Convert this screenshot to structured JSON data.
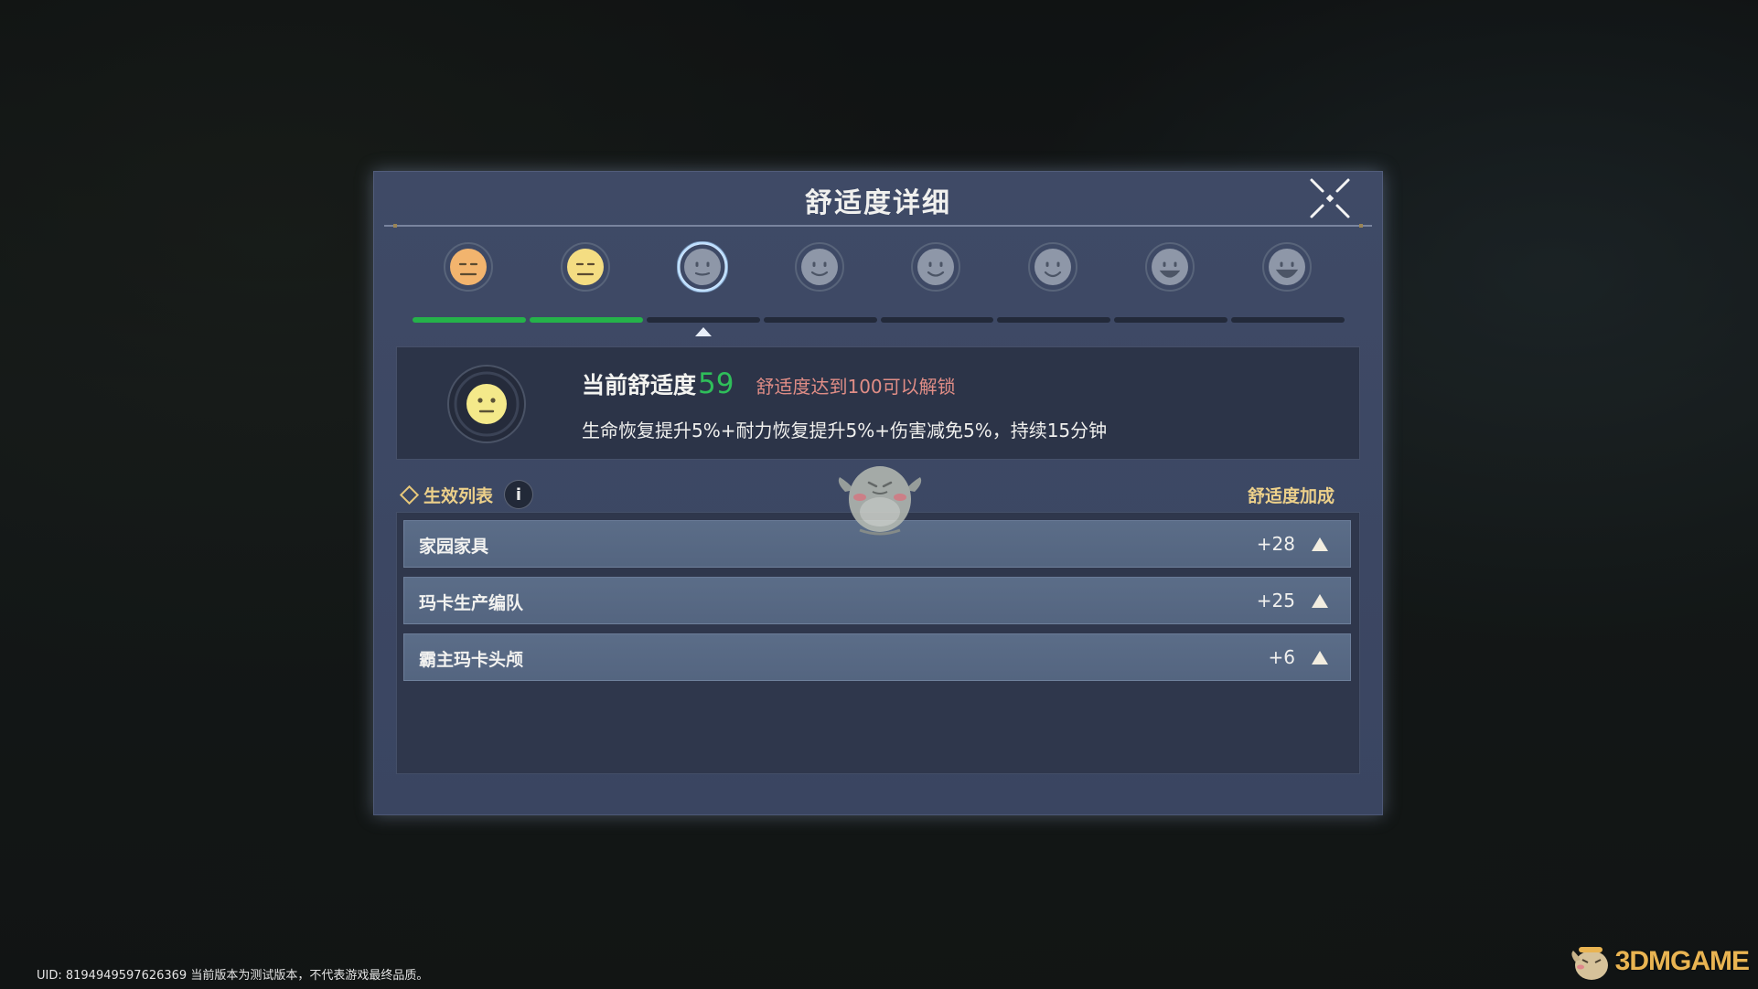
{
  "dialog": {
    "title": "舒适度详细",
    "close_icon": "close-icon"
  },
  "levels": {
    "faces": [
      {
        "name": "face-level-1",
        "color": "#f2b46e",
        "state": "unlocked"
      },
      {
        "name": "face-level-2",
        "color": "#f4dd82",
        "state": "unlocked"
      },
      {
        "name": "face-level-3",
        "color": "#8e97a8",
        "state": "current"
      },
      {
        "name": "face-level-4",
        "color": "#8e97a8",
        "state": "locked"
      },
      {
        "name": "face-level-5",
        "color": "#8e97a8",
        "state": "locked"
      },
      {
        "name": "face-level-6",
        "color": "#8e97a8",
        "state": "locked"
      },
      {
        "name": "face-level-7",
        "color": "#8e97a8",
        "state": "locked"
      },
      {
        "name": "face-level-8",
        "color": "#8e97a8",
        "state": "locked"
      }
    ],
    "filled_segments": 2,
    "total_segments": 8,
    "current_index": 2
  },
  "status": {
    "current_label": "当前舒适度",
    "current_value": "59",
    "unlock_note": "舒适度达到100可以解锁",
    "effect": "生命恢复提升5%+耐力恢复提升5%+伤害减免5%，持续15分钟"
  },
  "list": {
    "title": "生效列表",
    "info_icon_text": "i",
    "bonus_header": "舒适度加成",
    "rows": [
      {
        "label": "家园家具",
        "value": "+28"
      },
      {
        "label": "玛卡生产编队",
        "value": "+25"
      },
      {
        "label": "霸主玛卡头颅",
        "value": "+6"
      }
    ]
  },
  "footer": {
    "uid_text": "UID: 8194949597626369 当前版本为测试版本，不代表游戏最终品质。",
    "watermark": "3DMGAME"
  },
  "colors": {
    "accent_gold": "#ecd08a",
    "value_green": "#2fbe5a",
    "note_red": "#e08d86",
    "progress_green": "#25b24a"
  }
}
